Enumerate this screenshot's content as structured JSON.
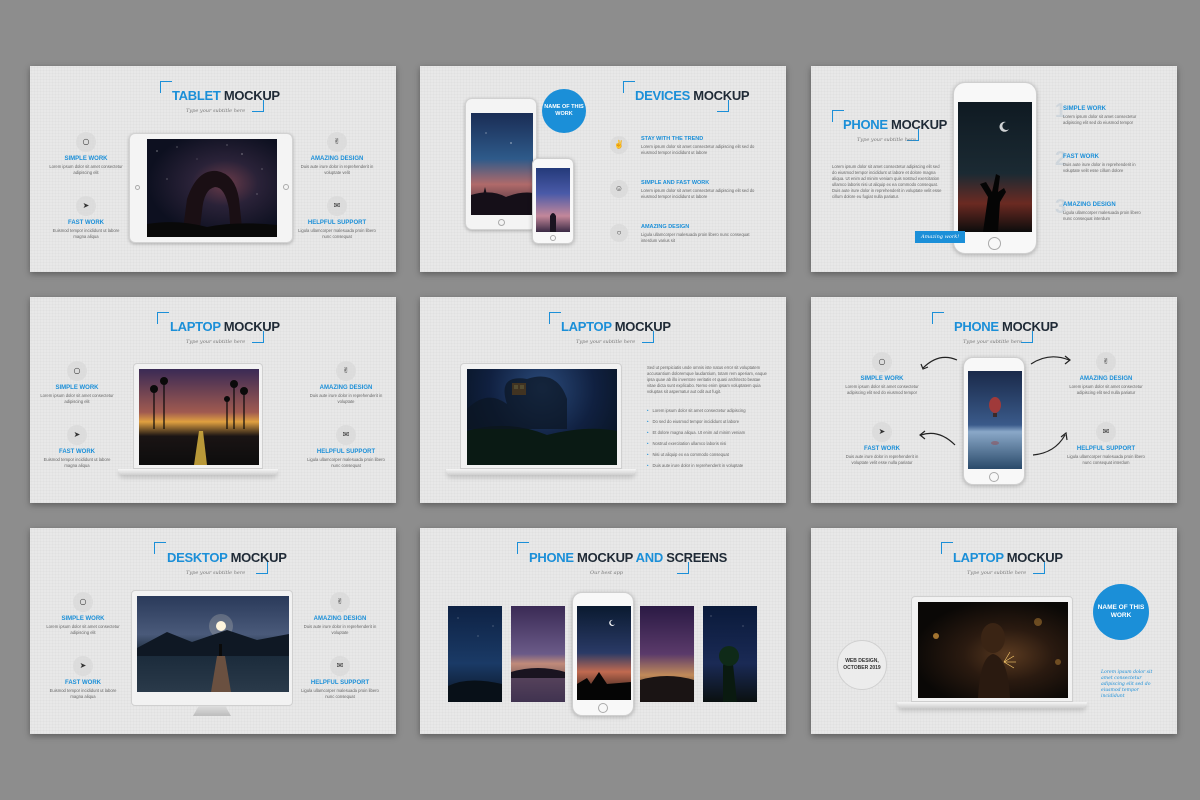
{
  "slides": {
    "s1": {
      "title_accent": "TABLET",
      "title_dark": "MOCKUP",
      "subtitle": "Type your subtitle here",
      "features": [
        {
          "icon": "lightbulb-icon",
          "glyph": "○",
          "title": "SIMPLE WORK",
          "body": "Lorem ipsum dolor sit amet consectetur adipiscing elit"
        },
        {
          "icon": "paper-plane-icon",
          "glyph": "➤",
          "title": "FAST WORK",
          "body": "Euismod tempor incididunt ut labore magna aliqua"
        },
        {
          "icon": "victory-hand-icon",
          "glyph": "✌",
          "title": "AMAZING DESIGN",
          "body": "Duis aute irure dolor in reprehenderit in voluptate velit"
        },
        {
          "icon": "chat-bubble-icon",
          "glyph": "✉",
          "title": "HELPFUL SUPPORT",
          "body": "Ligula ullamcorper malesuada proin libero nunc consequat"
        }
      ]
    },
    "s2": {
      "title_accent": "DEVICES",
      "title_dark": "MOCKUP",
      "badge": "NAME OF THIS WORK",
      "features": [
        {
          "icon": "victory-hand-icon",
          "glyph": "✌",
          "title": "STAY WITH THE TREND",
          "body": "Lorem ipsum dolor sit amet consectetur adipiscing elit sed do eiusmod tempor incididunt ut labore"
        },
        {
          "icon": "smiley-icon",
          "glyph": "☺",
          "title": "SIMPLE AND FAST WORK",
          "body": "Lorem ipsum dolor sit amet consectetur adipiscing elit sed do eiusmod tempor incididunt ut labore"
        },
        {
          "icon": "lightbulb-icon",
          "glyph": "○",
          "title": "AMAZING DESIGN",
          "body": "Ligula ullamcorper malesuada proin libero nunc consequat interdum varius sit"
        }
      ]
    },
    "s3": {
      "title_accent": "PHONE",
      "title_dark": "MOCKUP",
      "subtitle": "Type your subtitle here",
      "body": "Lorem ipsum dolor sit amet consectetur adipiscing elit sed do eiusmod tempor incididunt ut labore et dolore magna aliqua. Ut enim ad minim veniam quis nostrud exercitation ullamco laboris nisi ut aliquip ex ea commodo consequat. Duis aute irure dolor in reprehenderit in voluptate velit esse cillum dolore eu fugiat nulla pariatur.",
      "tag": "Amazing work!",
      "items": [
        {
          "num": "1",
          "title": "SIMPLE WORK",
          "body": "Lorem ipsum dolor sit amet consectetur adipiscing elit sed do eiusmod tempor"
        },
        {
          "num": "2",
          "title": "FAST WORK",
          "body": "Duis aute irure dolor in reprehenderit in voluptate velit esse cillum dolore"
        },
        {
          "num": "3",
          "title": "AMAZING DESIGN",
          "body": "Ligula ullamcorper malesuada proin libero nunc consequat interdum"
        }
      ]
    },
    "s4": {
      "title_accent": "LAPTOP",
      "title_dark": "MOCKUP",
      "subtitle": "Type your subtitle here",
      "features": [
        {
          "icon": "lightbulb-icon",
          "glyph": "○",
          "title": "SIMPLE WORK",
          "body": "Lorem ipsum dolor sit amet consectetur adipiscing elit"
        },
        {
          "icon": "paper-plane-icon",
          "glyph": "➤",
          "title": "FAST WORK",
          "body": "Euismod tempor incididunt ut labore magna aliqua"
        },
        {
          "icon": "victory-hand-icon",
          "glyph": "✌",
          "title": "AMAZING DESIGN",
          "body": "Duis aute irure dolor in reprehenderit in voluptate"
        },
        {
          "icon": "chat-bubble-icon",
          "glyph": "✉",
          "title": "HELPFUL SUPPORT",
          "body": "Ligula ullamcorper malesuada proin libero nunc consequat"
        }
      ]
    },
    "s5": {
      "title_accent": "LAPTOP",
      "title_dark": "MOCKUP",
      "subtitle": "Type your subtitle here",
      "body": "Sed ut perspiciatis unde omnis iste natus error sit voluptatem accusantium doloremque laudantium, totam rem aperiam, eaque ipsa quae ab illo inventore veritatis et quasi architecto beatae vitae dicta sunt explicabo. Nemo enim ipsam voluptatem quia voluptas sit aspernatur aut odit aut fugit.",
      "bullets": [
        "Lorem ipsum dolor sit amet consectetur adipiscing",
        "Do sed do eiusmod tempor incididunt ut labore",
        "Et dolore magna aliqua. Ut enim ad minim veniam",
        "Nostrud exercitation ullamco laboris nisi",
        "Nisi ut aliquip ex ea commodo consequat",
        "Duis aute irure dolor in reprehenderit in voluptate"
      ]
    },
    "s6": {
      "title_accent": "PHONE",
      "title_dark": "MOCKUP",
      "subtitle": "Type your subtitle here",
      "features": [
        {
          "icon": "lightbulb-icon",
          "glyph": "○",
          "title": "SIMPLE WORK",
          "body": "Lorem ipsum dolor sit amet consectetur adipiscing elit sed do eiusmod tempor"
        },
        {
          "icon": "paper-plane-icon",
          "glyph": "➤",
          "title": "FAST WORK",
          "body": "Duis aute irure dolor in reprehenderit in voluptate velit esse nulla pariatur"
        },
        {
          "icon": "victory-hand-icon",
          "glyph": "✌",
          "title": "AMAZING DESIGN",
          "body": "Lorem ipsum dolor sit amet consectetur adipiscing elit sed nulla pariatur"
        },
        {
          "icon": "chat-bubble-icon",
          "glyph": "✉",
          "title": "HELPFUL SUPPORT",
          "body": "Ligula ullamcorper malesuada proin libero nunc consequat interdum"
        }
      ]
    },
    "s7": {
      "title_accent": "DESKTOP",
      "title_dark": "MOCKUP",
      "subtitle": "Type your subtitle here",
      "features": [
        {
          "icon": "lightbulb-icon",
          "glyph": "○",
          "title": "SIMPLE WORK",
          "body": "Lorem ipsum dolor sit amet consectetur adipiscing elit"
        },
        {
          "icon": "paper-plane-icon",
          "glyph": "➤",
          "title": "FAST WORK",
          "body": "Euismod tempor incididunt ut labore magna aliqua"
        },
        {
          "icon": "victory-hand-icon",
          "glyph": "✌",
          "title": "AMAZING DESIGN",
          "body": "Duis aute irure dolor in reprehenderit in voluptate"
        },
        {
          "icon": "chat-bubble-icon",
          "glyph": "✉",
          "title": "HELPFUL SUPPORT",
          "body": "Ligula ullamcorper malesuada proin libero nunc consequat"
        }
      ]
    },
    "s8": {
      "title_accent": "PHONE",
      "title_dark": "MOCKUP",
      "title_accent2": "AND",
      "title_dark2": "SCREENS",
      "subtitle": "Our best app"
    },
    "s9": {
      "title_accent": "LAPTOP",
      "title_dark": "MOCKUP",
      "subtitle": "Type your subtitle here",
      "badge": "NAME OF THIS WORK",
      "outline_badge": "WEB DESIGN, OCTOBER 2019",
      "script": "Lorem ipsum dolor sit amet consectetur adipiscing elit sed do eiusmod tempor incididunt"
    }
  },
  "colors": {
    "accent": "#1b8fd8",
    "dark": "#1f2a36",
    "background": "#8d8d8d",
    "slide": "#e8e8e8"
  }
}
